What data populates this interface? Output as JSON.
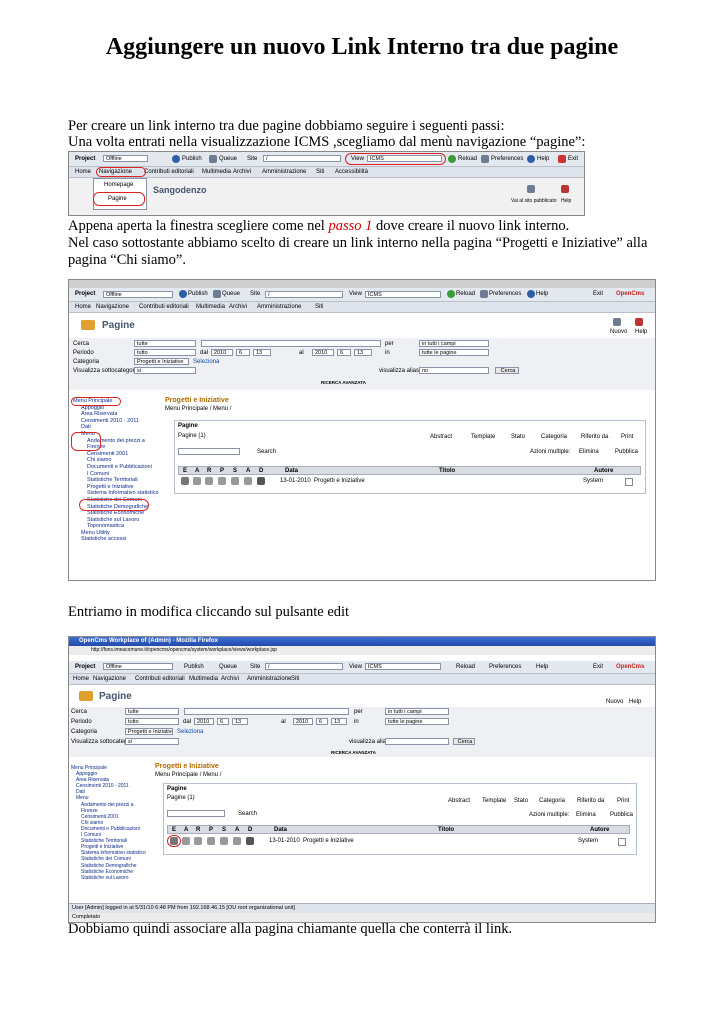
{
  "title": "Aggiungere un nuovo Link Interno tra due pagine",
  "para1": {
    "line1": "Per creare un link interno tra due pagine dobbiamo seguire i seguenti passi:",
    "line2": "Una volta entrati nella visualizzazione ICMS ,scegliamo dal menù navigazione “pagine”:"
  },
  "para2": {
    "line1_pre": "Appena aperta la finestra scegliere come nel ",
    "line1_em": "passo 1",
    "line1_post": " dove creare il nuovo link interno.",
    "line2": "Nel caso sottostante abbiamo scelto di creare un link interno nella pagina “Progetti e Iniziative” alla",
    "line3": "pagina “Chi siamo”."
  },
  "para3": "Entriamo in modifica cliccando sul pulsante edit",
  "para4": "Dobbiamo quindi associare alla pagina chiamante quella che conterrà il link.",
  "ui": {
    "project_label": "Project",
    "project_value": "Offline",
    "publish": "Publish",
    "queue": "Queue",
    "site_label": "Site",
    "site_value": "/",
    "view_label": "View",
    "view_value": "ICMS",
    "reload": "Reload",
    "preferences": "Preferences",
    "help": "Help",
    "exit": "Exit",
    "opencms": "OpenCms",
    "menu": [
      "Home",
      "Navigazione",
      "Contributi editoriali",
      "Multimedia",
      "Archivi",
      "Amministrazione",
      "Siti",
      "Accessibilità"
    ],
    "menu_short": [
      "Home",
      "Navigazione",
      "Contributi editoriali",
      "Multimedia",
      "Archivi",
      "Amministrazione",
      "Siti"
    ],
    "dropdown": [
      "Homepage",
      "Pagine"
    ],
    "sangodenzo": "Sangodenzo",
    "vai_sito": "Vai al sito pubblicato",
    "help_small": "Help",
    "page_title": "Pagine",
    "nuovo": "Nuovo",
    "help2": "Help",
    "filters": {
      "cerca": "Cerca",
      "cerca_val": "tutte",
      "per": "per",
      "per_val": "in tutti i campi",
      "periodo": "Periodo",
      "periodo_val": "tutto",
      "dal": "dal",
      "al": "al",
      "year": "2010",
      "month": "6",
      "day": "13",
      "in": "in",
      "in_val": "tutte le pagine",
      "categoria": "Categoria",
      "categoria_val": "Progetti e Iniziative",
      "seleziona": "Seleziona",
      "visualizza": "Visualizza sottocategorie",
      "visualizza_val": "si",
      "visualizza_alias": "visualizza alias",
      "alias_val": "no",
      "cerca_btn": "Cerca",
      "ricerca_avanzata": "RICERCA AVANZATA"
    },
    "tree": [
      "Menu Principale",
      "Appoggio",
      "Area Riservata",
      "Censimenti 2010 - 2011",
      "Dati",
      "Menu",
      "Andamento dei prezzi a",
      "Firenze",
      "Censimenti 2001",
      "Chi siamo",
      "Documenti e Pubblicazioni",
      "I Comuni",
      "Statistiche Territoriali",
      "Progetti e Iniziative",
      "Sistema Informativo statistico",
      "Statistiche dei Comuni",
      "Statistiche Demografiche",
      "Statistiche Economiche",
      "Statistiche sul Lavoro",
      "Toponomastica",
      "Menu Utility",
      "Statistiche accessi"
    ],
    "tree_small": [
      "Menu Principale",
      "Appoggio",
      "Area Riservata",
      "Censimenti 2010 - 2011",
      "Dati",
      "Menu",
      "Andamento dei prezzi a",
      "Firenze",
      "Censimenti 2001",
      "Chi siamo",
      "Documenti e Pubblicazioni",
      "I Comuni",
      "Statistiche Territoriali",
      "Progetti e Iniziative",
      "Sistema informativo statistico",
      "Statistiche dei Comuni",
      "Statistiche Demografiche",
      "Statistiche Economiche",
      "Statistiche sul Lavoro"
    ],
    "content_title": "Progetti e Iniziative",
    "breadcrumb": "Menu Principale / Menu /",
    "pagine": "Pagine",
    "pagine_count": "Pagine (1)",
    "abstract": "Abstract",
    "template": "Template",
    "stato": "Stato",
    "categoria": "Categoria",
    "riferito": "Riferito da",
    "print": "Print",
    "search": "Search",
    "azioni": "Azioni multiple:",
    "elimina": "Elimina",
    "pubblica": "Pubblica",
    "cols": [
      "E",
      "A",
      "R",
      "P",
      "S",
      "A",
      "D",
      "Data",
      "Titolo",
      "Autore"
    ],
    "row_date": "13-01-2010",
    "row_title": "Progetti e Iniziative",
    "row_author": "System",
    "window_title": "OpenCms Workplace of (Admin) - Mozilla Firefox",
    "url": "http://fons.imeacomune.it/opencms/opencms/system/workplace/views/workplace.jsp",
    "status_user": "User [Admin] logged in at 5/31/10 6:48 PM from 192.168.46.15 [OU root organizational unit]",
    "status_done": "Completato"
  }
}
